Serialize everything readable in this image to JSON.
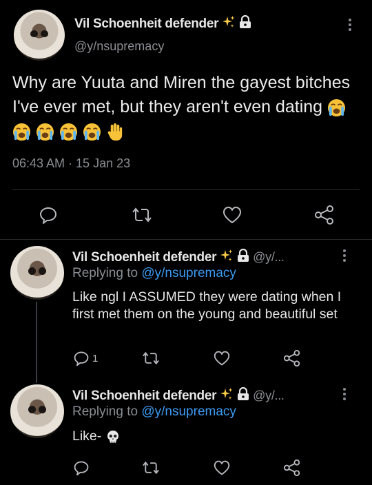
{
  "main_tweet": {
    "author_name": "Vil Schoenheit defender",
    "handle": "@y/nsupremacy",
    "text": "Why are Yuuta and Miren the gayest bitches I've ever met, but they aren't even dating",
    "emojis": [
      "loudly-crying-face",
      "loudly-crying-face",
      "loudly-crying-face",
      "loudly-crying-face",
      "loudly-crying-face",
      "raised-hand"
    ],
    "timestamp": "06:43 AM · 15 Jan 23"
  },
  "replies": [
    {
      "author_name": "Vil Schoenheit defender",
      "handle": "@y/...",
      "replying_prefix": "Replying to ",
      "replying_to": "@y/nsupremacy",
      "text": "Like ngl I ASSUMED they were dating when I first met them on the young and beautiful set",
      "reply_count": "1"
    },
    {
      "author_name": "Vil Schoenheit defender",
      "handle": "@y/...",
      "replying_prefix": "Replying to ",
      "replying_to": "@y/nsupremacy",
      "text": "Like-",
      "emoji": "skull"
    }
  ],
  "colors": {
    "background": "#000000",
    "link": "#3b99f0",
    "secondary": "#8a8d91"
  }
}
